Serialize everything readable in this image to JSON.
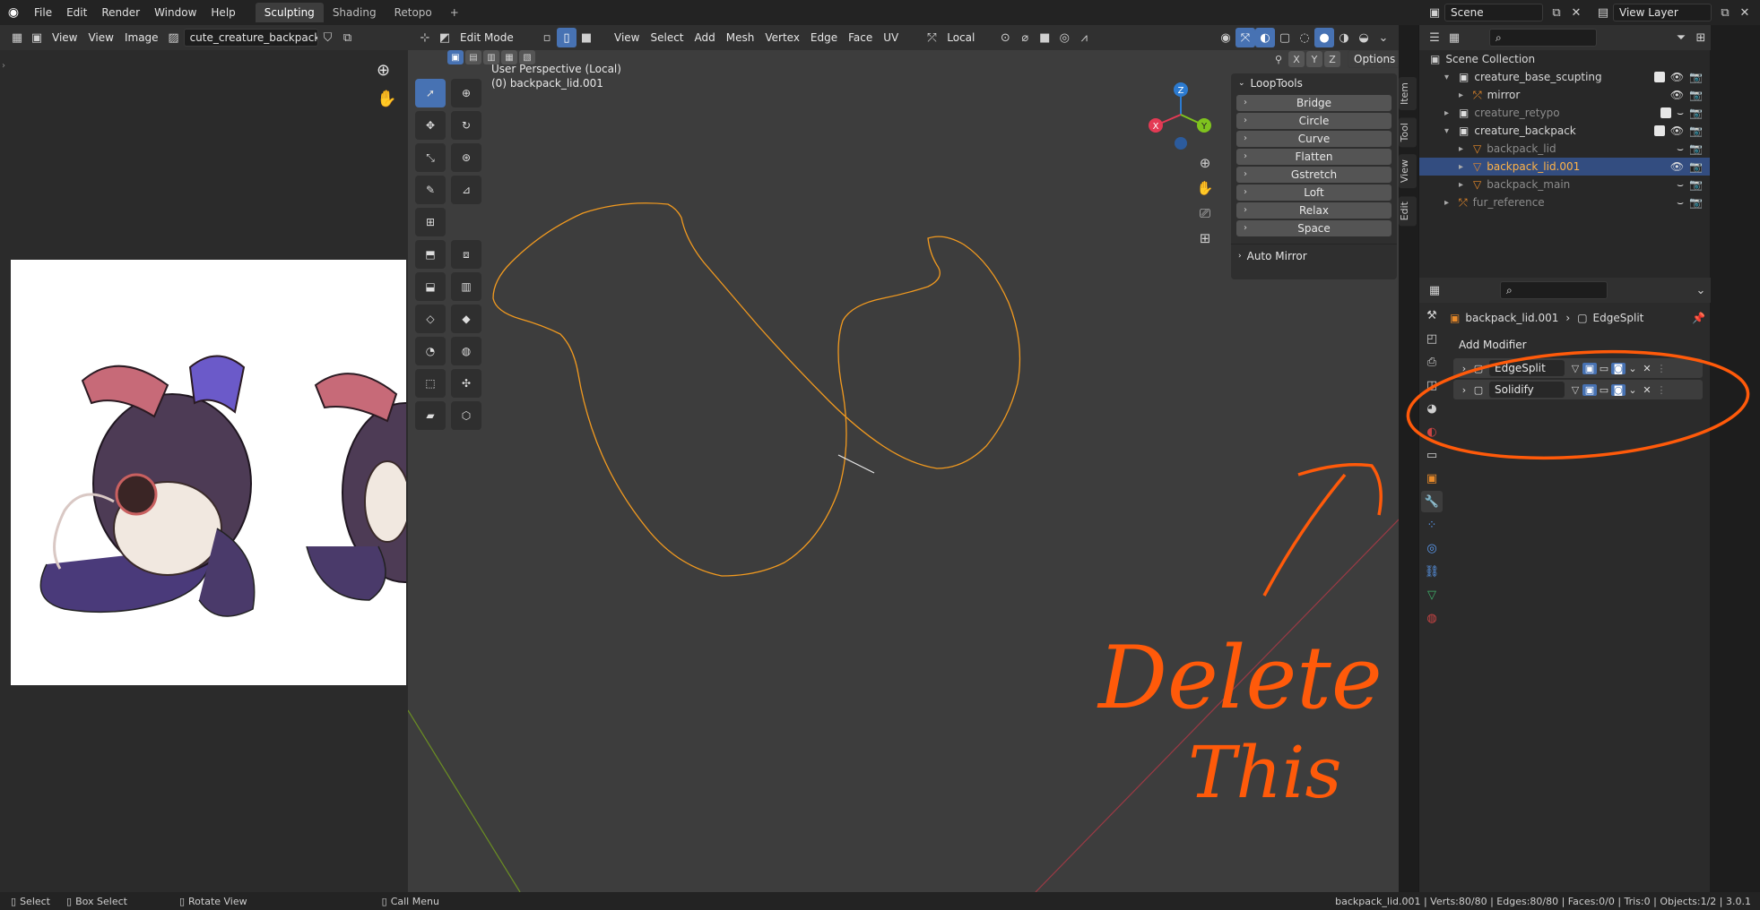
{
  "topbar": {
    "menus": [
      "File",
      "Edit",
      "Render",
      "Window",
      "Help"
    ],
    "workspace_tabs": [
      "Sculpting",
      "Shading",
      "Retopo"
    ],
    "active_tab": "Sculpting",
    "add_tab": "+",
    "scene_label": "Scene",
    "view_layer_label": "View Layer"
  },
  "image_editor": {
    "view_menu": "View",
    "menus": [
      "View",
      "Image"
    ],
    "image_name": "cute_creature_backpack.jpg"
  },
  "viewport": {
    "mode": "Edit Mode",
    "menus": [
      "View",
      "Select",
      "Add",
      "Mesh",
      "Vertex",
      "Edge",
      "Face",
      "UV"
    ],
    "transform_orientation": "Local",
    "axes": [
      "X",
      "Y",
      "Z"
    ],
    "options_label": "Options",
    "perspective_label": "User Perspective (Local)",
    "object_label": "(0) backpack_lid.001",
    "gizmo_axes": [
      "X",
      "Y",
      "Z"
    ]
  },
  "n_panel": {
    "title": "LoopTools",
    "buttons": [
      "Bridge",
      "Circle",
      "Curve",
      "Flatten",
      "Gstretch",
      "Loft",
      "Relax",
      "Space"
    ],
    "auto_mirror": "Auto Mirror",
    "tabs": [
      "Item",
      "Tool",
      "View",
      "Edit"
    ]
  },
  "outliner": {
    "root": "Scene Collection",
    "rows": [
      {
        "label": "creature_base_scupting",
        "indent": 1,
        "type": "collection"
      },
      {
        "label": "mirror",
        "indent": 2,
        "type": "object"
      },
      {
        "label": "creature_retypo",
        "indent": 1,
        "type": "collection",
        "dim": true
      },
      {
        "label": "creature_backpack",
        "indent": 1,
        "type": "collection"
      },
      {
        "label": "backpack_lid",
        "indent": 2,
        "type": "mesh",
        "dim": true
      },
      {
        "label": "backpack_lid.001",
        "indent": 2,
        "type": "mesh",
        "selected": true
      },
      {
        "label": "backpack_main",
        "indent": 2,
        "type": "mesh",
        "dim": true
      },
      {
        "label": "fur_reference",
        "indent": 1,
        "type": "object",
        "dim": true
      }
    ]
  },
  "properties": {
    "object_name": "backpack_lid.001",
    "modifier_crumb": "EdgeSplit",
    "add_modifier": "Add Modifier",
    "modifiers": [
      {
        "name": "EdgeSplit"
      },
      {
        "name": "Solidify"
      }
    ]
  },
  "annotation": {
    "line1": "Delete",
    "line2": "This",
    "color": "#ff5a0a"
  },
  "statusbar": {
    "select": "Select",
    "box_select": "Box Select",
    "rotate_view": "Rotate View",
    "call_menu": "Call Menu",
    "stats": "backpack_lid.001 | Verts:80/80 | Edges:80/80 | Faces:0/0 | Tris:0 | Objects:1/2 | 3.0.1"
  }
}
